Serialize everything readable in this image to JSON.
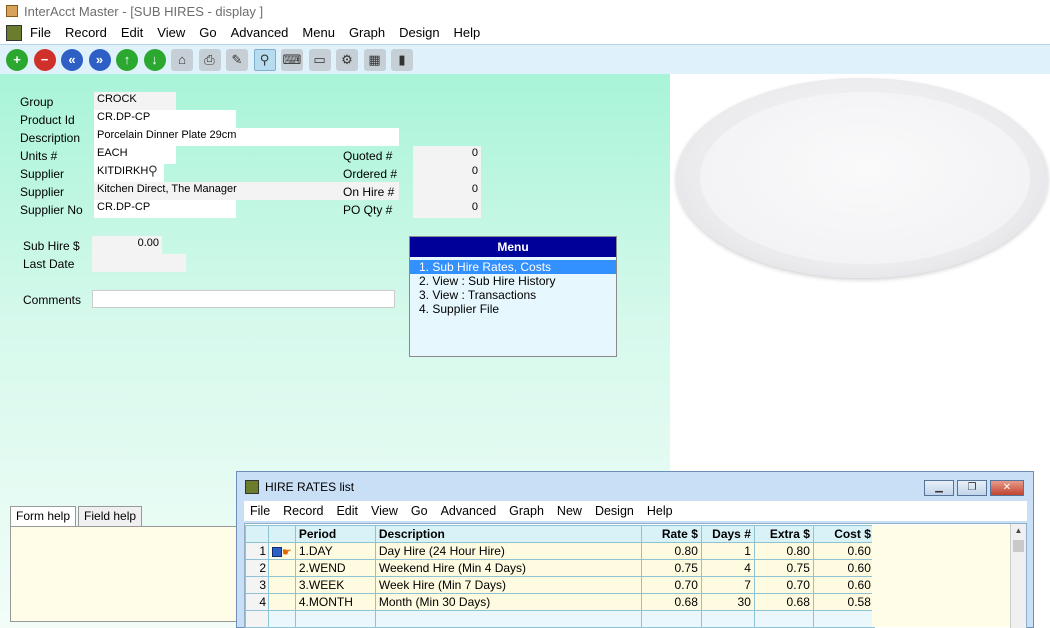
{
  "window": {
    "title": "InterAcct Master - [SUB HIRES - display ]"
  },
  "menubar": {
    "items": [
      "File",
      "Record",
      "Edit",
      "View",
      "Go",
      "Advanced",
      "Menu",
      "Graph",
      "Design",
      "Help"
    ]
  },
  "toolbar": {
    "buttons": [
      {
        "icon": "add-icon",
        "glyph": "+"
      },
      {
        "icon": "remove-icon",
        "glyph": "−"
      },
      {
        "icon": "first-record-icon",
        "glyph": "«"
      },
      {
        "icon": "last-record-icon",
        "glyph": "»"
      },
      {
        "icon": "previous-record-icon",
        "glyph": "↑"
      },
      {
        "icon": "next-record-icon",
        "glyph": "↓"
      },
      {
        "icon": "home-icon",
        "glyph": "⌂"
      },
      {
        "icon": "print-icon",
        "glyph": "⎙"
      },
      {
        "icon": "export-icon",
        "glyph": "✎"
      },
      {
        "icon": "search-icon",
        "glyph": "⚲"
      },
      {
        "icon": "keyboard-icon",
        "glyph": "⌨"
      },
      {
        "icon": "monitor-icon",
        "glyph": "▭"
      },
      {
        "icon": "settings-icon",
        "glyph": "⚙"
      },
      {
        "icon": "calendar-icon",
        "glyph": "▦"
      },
      {
        "icon": "exit-door-icon",
        "glyph": "▮"
      }
    ]
  },
  "form": {
    "group_label": "Group",
    "group": "CROCK",
    "product_id_label": "Product Id",
    "product_id": "CR.DP-CP",
    "description_label": "Description",
    "description": "Porcelain Dinner Plate 29cm",
    "units_label": "Units #",
    "units": "EACH",
    "supplier_label": "Supplier",
    "supplier_code": "KITDIRKH",
    "supplier_name_label": "Supplier",
    "supplier_name": "Kitchen Direct, The Manager",
    "supplier_no_label": "Supplier No",
    "supplier_no": "CR.DP-CP",
    "quoted_label": "Quoted #",
    "quoted": "0",
    "ordered_label": "Ordered #",
    "ordered": "0",
    "on_hire_label": "On Hire #",
    "on_hire": "0",
    "po_qty_label": "PO Qty #",
    "po_qty": "0",
    "sub_hire_label": "Sub Hire $",
    "sub_hire": "0.00",
    "last_date_label": "Last Date",
    "last_date": "",
    "comments_label": "Comments",
    "comments": ""
  },
  "menu": {
    "title": "Menu",
    "options": [
      "1. Sub Hire Rates, Costs",
      "2. View : Sub Hire History",
      "3. View : Transactions",
      "4. Supplier File"
    ]
  },
  "help": {
    "tabs": [
      "Form help",
      "Field help"
    ]
  },
  "child": {
    "title": "HIRE RATES list",
    "menu": [
      "File",
      "Record",
      "Edit",
      "View",
      "Go",
      "Advanced",
      "Graph",
      "New",
      "Design",
      "Help"
    ],
    "columns": [
      "Period",
      "Description",
      "Rate $",
      "Days #",
      "Extra $",
      "Cost $"
    ],
    "rows": [
      {
        "n": "1",
        "period": "1.DAY",
        "description": "Day Hire (24 Hour Hire)",
        "rate": "0.80",
        "days": "1",
        "extra": "0.80",
        "cost": "0.60"
      },
      {
        "n": "2",
        "period": "2.WEND",
        "description": "Weekend Hire (Min 4 Days)",
        "rate": "0.75",
        "days": "4",
        "extra": "0.75",
        "cost": "0.60"
      },
      {
        "n": "3",
        "period": "3.WEEK",
        "description": "Week Hire (Min 7 Days)",
        "rate": "0.70",
        "days": "7",
        "extra": "0.70",
        "cost": "0.60"
      },
      {
        "n": "4",
        "period": "4.MONTH",
        "description": "Month (Min 30 Days)",
        "rate": "0.68",
        "days": "30",
        "extra": "0.68",
        "cost": "0.58"
      }
    ]
  }
}
